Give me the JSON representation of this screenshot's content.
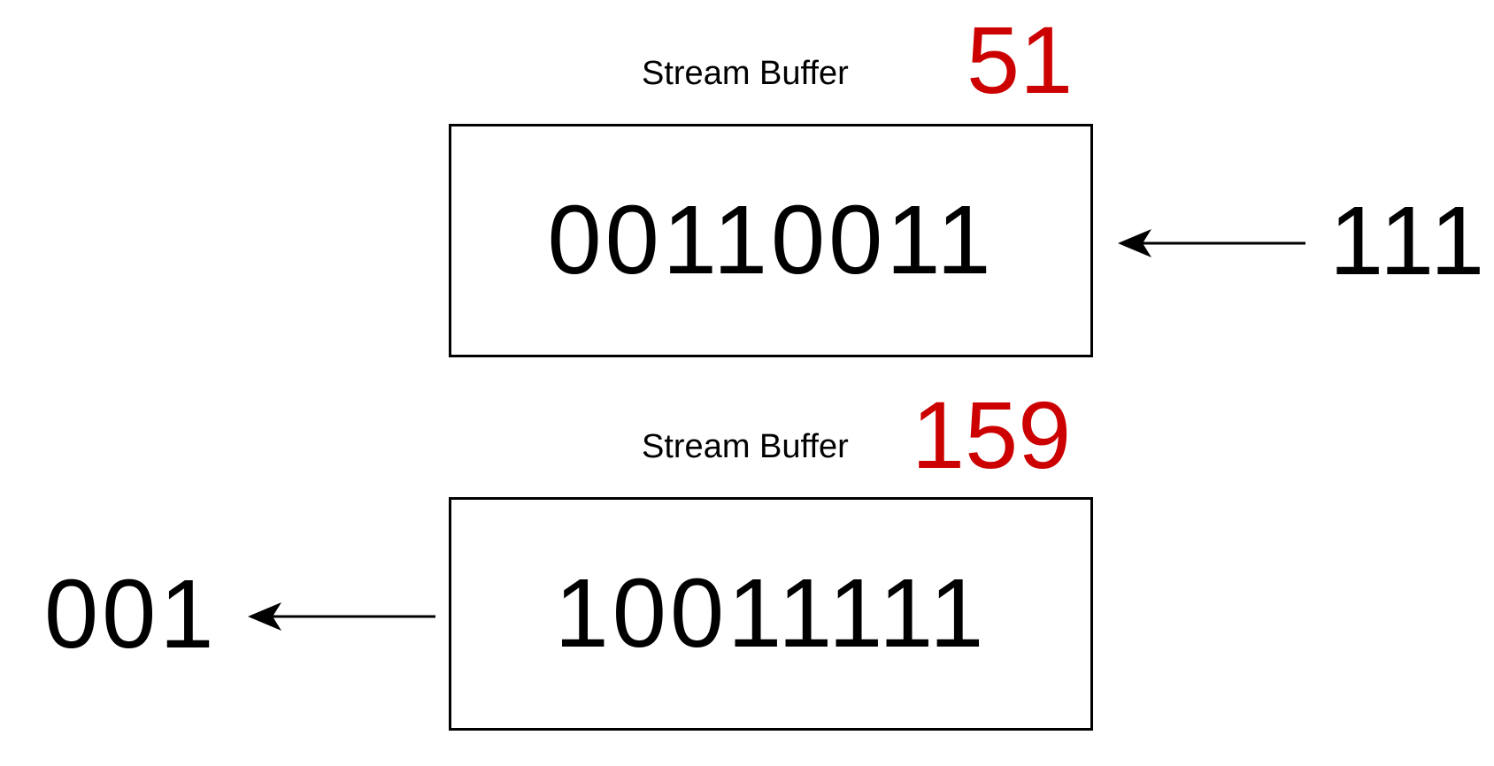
{
  "colors": {
    "accent": "#cc0000",
    "stroke": "#000000"
  },
  "buffers": [
    {
      "caption": "Stream Buffer",
      "decimal": "51",
      "bits": "00110011",
      "incoming_bits": "111"
    },
    {
      "caption": "Stream Buffer",
      "decimal": "159",
      "bits": "10011111",
      "outgoing_bits": "001"
    }
  ]
}
